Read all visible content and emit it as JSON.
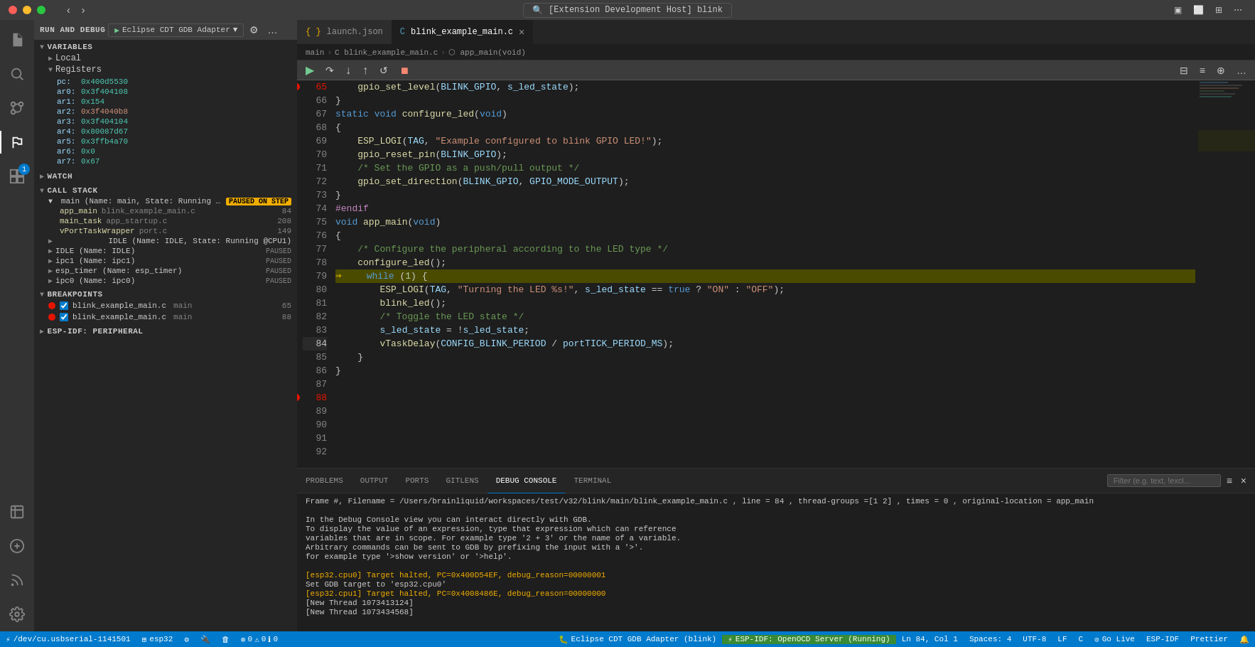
{
  "titlebar": {
    "title": "[Extension Development Host] blink",
    "nav_back": "‹",
    "nav_forward": "›"
  },
  "debug_toolbar": {
    "title": "RUN AND DEBUG",
    "adapter_label": "Eclipse CDT GDB Adapter",
    "adapter_icon": "▶",
    "pause": "⏸",
    "continue": "▷",
    "step_over": "↷",
    "step_into": "↓",
    "step_out": "↑",
    "restart": "↺",
    "stop": "⏹",
    "settings": "⚙",
    "more": "…"
  },
  "tabs": {
    "launch_json": "launch.json",
    "main_file": "blink_example_main.c",
    "main_file_dirty": false
  },
  "breadcrumb": {
    "part1": "main",
    "sep1": ">",
    "part2": "C blink_example_main.c",
    "sep2": ">",
    "part3": "⬡ app_main(void)"
  },
  "code": {
    "lines": [
      {
        "num": 65,
        "bp": true,
        "arrow": false,
        "content": "    gpio_set_level(BLINK_GPIO, s_led_state);"
      },
      {
        "num": 66,
        "bp": false,
        "arrow": false,
        "content": "}"
      },
      {
        "num": 67,
        "bp": false,
        "arrow": false,
        "content": ""
      },
      {
        "num": 68,
        "bp": false,
        "arrow": false,
        "content": "static void configure_led(void)"
      },
      {
        "num": 69,
        "bp": false,
        "arrow": false,
        "content": "{"
      },
      {
        "num": 70,
        "bp": false,
        "arrow": false,
        "content": "    ESP_LOGI(TAG, \"Example configured to blink GPIO LED!\");"
      },
      {
        "num": 71,
        "bp": false,
        "arrow": false,
        "content": "    gpio_reset_pin(BLINK_GPIO);"
      },
      {
        "num": 72,
        "bp": false,
        "arrow": false,
        "content": "    /* Set the GPIO as a push/pull output */"
      },
      {
        "num": 73,
        "bp": false,
        "arrow": false,
        "content": "    gpio_set_direction(BLINK_GPIO, GPIO_MODE_OUTPUT);"
      },
      {
        "num": 74,
        "bp": false,
        "arrow": false,
        "content": "}"
      },
      {
        "num": 75,
        "bp": false,
        "arrow": false,
        "content": ""
      },
      {
        "num": 76,
        "bp": false,
        "arrow": false,
        "content": "#endif"
      },
      {
        "num": 77,
        "bp": false,
        "arrow": false,
        "content": ""
      },
      {
        "num": 78,
        "bp": false,
        "arrow": false,
        "content": "void app_main(void)"
      },
      {
        "num": 79,
        "bp": false,
        "arrow": false,
        "content": "{"
      },
      {
        "num": 80,
        "bp": false,
        "arrow": false,
        "content": ""
      },
      {
        "num": 81,
        "bp": false,
        "arrow": false,
        "content": "    /* Configure the peripheral according to the LED type */"
      },
      {
        "num": 82,
        "bp": false,
        "arrow": false,
        "content": "    configure_led();"
      },
      {
        "num": 83,
        "bp": false,
        "arrow": false,
        "content": ""
      },
      {
        "num": 84,
        "bp": false,
        "arrow": true,
        "content": "    while (1) {",
        "highlighted": true
      },
      {
        "num": 85,
        "bp": false,
        "arrow": false,
        "content": "        ESP_LOGI(TAG, \"Turning the LED %s!\", s_led_state == true ? \"ON\" : \"OFF\");"
      },
      {
        "num": 86,
        "bp": false,
        "arrow": false,
        "content": "        blink_led();"
      },
      {
        "num": 87,
        "bp": false,
        "arrow": false,
        "content": "        /* Toggle the LED state */"
      },
      {
        "num": 88,
        "bp": true,
        "arrow": false,
        "content": "        s_led_state = !s_led_state;"
      },
      {
        "num": 89,
        "bp": false,
        "arrow": false,
        "content": "        vTaskDelay(CONFIG_BLINK_PERIOD / portTICK_PERIOD_MS);"
      },
      {
        "num": 90,
        "bp": false,
        "arrow": false,
        "content": "    }"
      },
      {
        "num": 91,
        "bp": false,
        "arrow": false,
        "content": "}"
      },
      {
        "num": 92,
        "bp": false,
        "arrow": false,
        "content": ""
      }
    ]
  },
  "sidebar": {
    "variables_title": "VARIABLES",
    "local_label": "Local",
    "registers_label": "Registers",
    "registers": [
      {
        "name": "pc:",
        "val": "0x400d5530",
        "changed": false
      },
      {
        "name": "ar0:",
        "val": "0x3f404108",
        "changed": false
      },
      {
        "name": "ar1:",
        "val": "0x154",
        "changed": false
      },
      {
        "name": "ar2:",
        "val": "0x3f4040b8",
        "changed": true
      },
      {
        "name": "ar3:",
        "val": "0x3f404104",
        "changed": false
      },
      {
        "name": "ar4:",
        "val": "0x80087d67",
        "changed": false
      },
      {
        "name": "ar5:",
        "val": "0x3ffb4a70",
        "changed": false
      },
      {
        "name": "ar6:",
        "val": "0x0",
        "changed": false
      },
      {
        "name": "ar7:",
        "val": "0x67",
        "changed": false
      }
    ],
    "watch_title": "WATCH",
    "call_stack_title": "CALL STACK",
    "call_stack": [
      {
        "name": "main (Name: main, State: Running ...)",
        "badge": "PAUSED ON STEP",
        "indent": 0
      },
      {
        "fn": "app_main",
        "file": "blink_example_main.c",
        "line": "84",
        "indent": 1
      },
      {
        "fn": "main_task",
        "file": "app_startup.c",
        "line": "208",
        "indent": 1
      },
      {
        "fn": "vPortTaskWrapper",
        "file": "port.c",
        "line": "149",
        "indent": 1
      }
    ],
    "threads": [
      {
        "name": "IDLE (Name: IDLE, State: Running @CPU1)",
        "state": ""
      },
      {
        "name": "IDLE (Name: IDLE)",
        "state": "PAUSED"
      },
      {
        "name": "ipc1 (Name: ipc1)",
        "state": "PAUSED"
      },
      {
        "name": "esp_timer (Name: esp_timer)",
        "state": "PAUSED"
      },
      {
        "name": "ipc0 (Name: ipc0)",
        "state": "PAUSED"
      }
    ],
    "breakpoints_title": "BREAKPOINTS",
    "breakpoints": [
      {
        "file": "blink_example_main.c",
        "fn": "main",
        "line": "65",
        "checked": true
      },
      {
        "file": "blink_example_main.c",
        "fn": "main",
        "line": "88",
        "checked": true
      }
    ],
    "esp_idf_label": "ESP-IDF: PERIPHERAL"
  },
  "panel": {
    "tabs": [
      "PROBLEMS",
      "OUTPUT",
      "PORTS",
      "GITLENS",
      "DEBUG CONSOLE",
      "TERMINAL"
    ],
    "active_tab": "DEBUG CONSOLE",
    "filter_placeholder": "Filter (e.g. text, !excl...",
    "console_lines": [
      {
        "text": "Frame #, Filename = /Users/brainliquid/workspaces/test/v32/blink/main/blink_example_main.c , line = 84 , thread-groups =[1 2] , times = 0 , original-location = app_main",
        "type": "info"
      },
      {
        "text": "",
        "type": "info"
      },
      {
        "text": "In the Debug Console view you can interact directly with GDB.",
        "type": "info"
      },
      {
        "text": "To display the value of an expression, type that expression which can reference",
        "type": "info"
      },
      {
        "text": "variables that are in scope. For example type '2 + 3' or the name of a variable.",
        "type": "info"
      },
      {
        "text": "Arbitrary commands can be sent to GDB by prefixing the input with a '>'.",
        "type": "info"
      },
      {
        "text": "for example type '>show version' or '>help'.",
        "type": "info"
      },
      {
        "text": "",
        "type": "info"
      },
      {
        "text": "[esp32.cpu0] Target halted, PC=0x400D54EF, debug_reason=00000001",
        "type": "warn"
      },
      {
        "text": "Set GDB target to 'esp32.cpu0'",
        "type": "info"
      },
      {
        "text": "[esp32.cpu1] Target halted, PC=0x4008486E, debug_reason=00000000",
        "type": "warn"
      },
      {
        "text": "[New Thread 1073413124]",
        "type": "info"
      },
      {
        "text": "[New Thread 1073434568]",
        "type": "info"
      }
    ]
  },
  "statusbar": {
    "debug_adapter": "Eclipse CDT GDB Adapter (blink)",
    "esp_idf": "ESP-IDF: OpenOCD Server (Running)",
    "port": "/dev/cu.usbserial-1141501",
    "chip": "esp32",
    "icons_left": [
      "⚡",
      "⚙",
      "🔌",
      "🗑"
    ],
    "errors": "0",
    "warnings": "0",
    "info": "0",
    "ln": "Ln 84, Col 1",
    "spaces": "Spaces: 4",
    "encoding": "UTF-8",
    "eol": "LF",
    "lang": "C",
    "goLive": "Go Live",
    "espidf": "ESP-IDF",
    "prettier": "Prettier"
  }
}
